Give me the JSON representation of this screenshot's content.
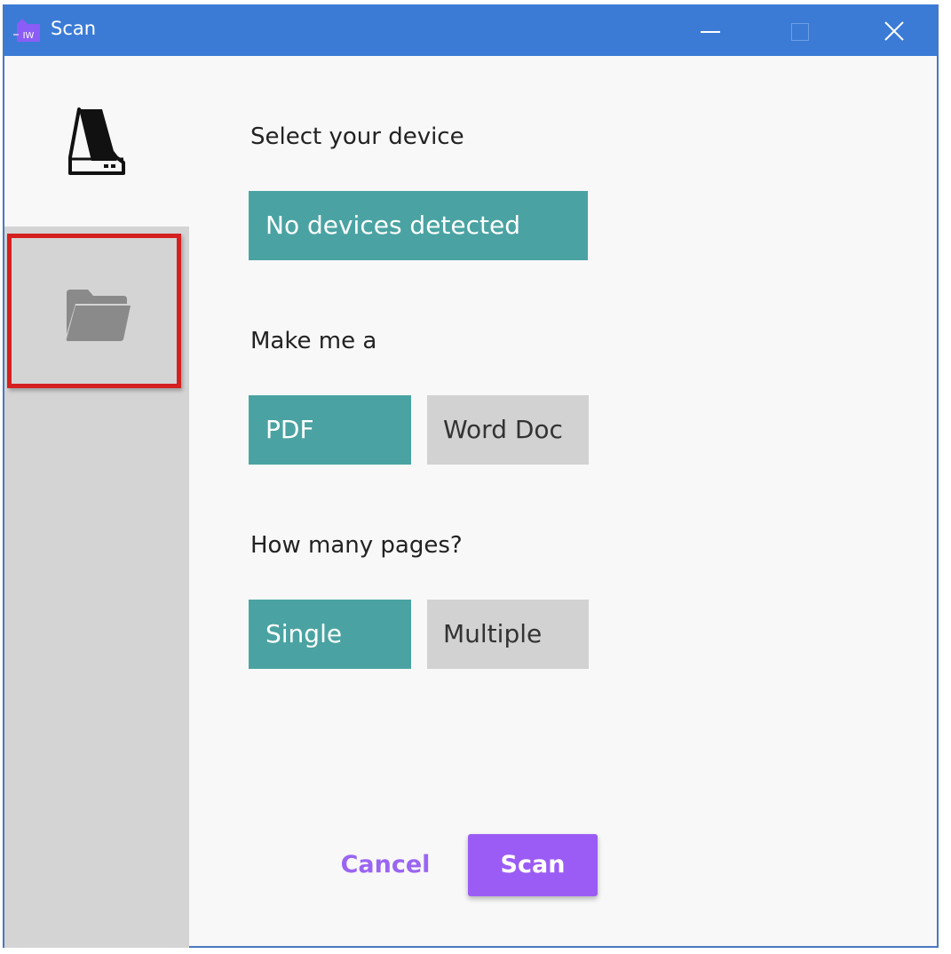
{
  "window": {
    "title": "Scan",
    "app_icon_text": "IW",
    "accent": "#3b7bd6"
  },
  "sidebar": {
    "items": [
      {
        "name": "scanner",
        "icon": "scanner-icon"
      },
      {
        "name": "folder",
        "icon": "folder-icon",
        "highlighted": true
      }
    ]
  },
  "form": {
    "device_label": "Select your device",
    "device_value": "No devices detected",
    "format_label": "Make me a",
    "format_options": [
      "PDF",
      "Word Doc"
    ],
    "format_selected": "PDF",
    "pages_label": "How many pages?",
    "pages_options": [
      "Single",
      "Multiple"
    ],
    "pages_selected": "Single"
  },
  "actions": {
    "cancel_label": "Cancel",
    "scan_label": "Scan"
  },
  "colors": {
    "selected": "#4aa3a2",
    "unselected": "#d2d2d2",
    "primary": "#9b5cf5",
    "highlight_border": "#d42020"
  }
}
